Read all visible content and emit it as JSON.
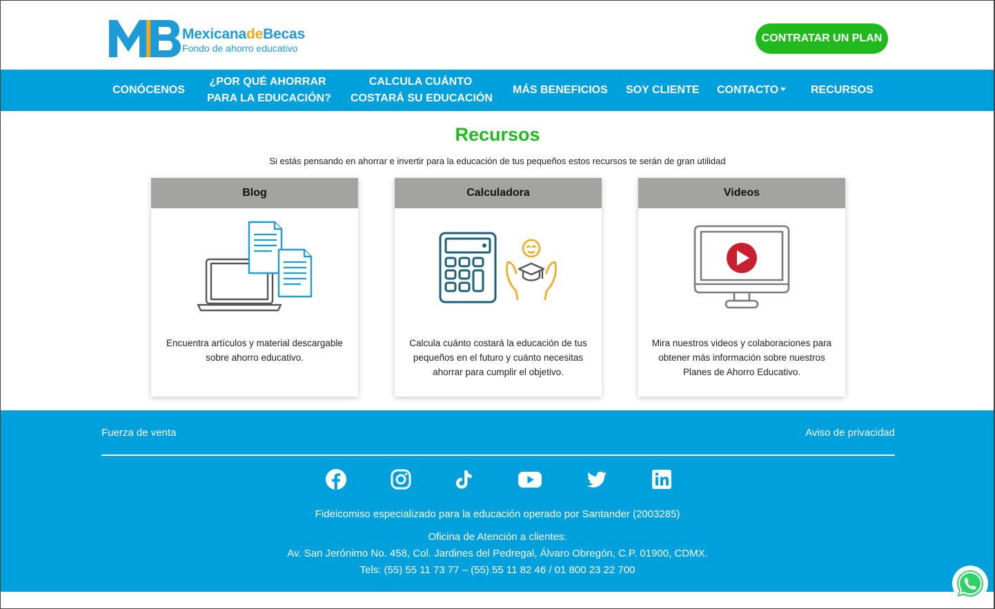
{
  "header": {
    "brand_part1": "Mexicana",
    "brand_part2": "de",
    "brand_part3": "Becas",
    "tagline": "Fondo de ahorro educativo",
    "cta_label": "CONTRATAR UN PLAN"
  },
  "nav": {
    "items": [
      {
        "line1": "CONÓCENOS",
        "line2": ""
      },
      {
        "line1": "¿POR QUÉ AHORRAR",
        "line2": "PARA LA EDUCACIÓN?"
      },
      {
        "line1": "CALCULA CUÁNTO",
        "line2": "COSTARÁ SU EDUCACIÓN"
      },
      {
        "line1": "MÁS BENEFICIOS",
        "line2": ""
      },
      {
        "line1": "SOY CLIENTE",
        "line2": ""
      },
      {
        "line1": "CONTACTO",
        "line2": ""
      },
      {
        "line1": "RECURSOS",
        "line2": ""
      }
    ]
  },
  "main": {
    "title": "Recursos",
    "subtitle": "Si estás pensando en ahorrar e invertir para la educación de tus pequeños estos recursos te serán de gran utilidad",
    "cards": [
      {
        "title": "Blog",
        "text": "Encuentra artículos y material descargable sobre ahorro educativo.",
        "icon": "laptop-documents-icon"
      },
      {
        "title": "Calculadora",
        "text": "Calcula cuánto costará la educación de tus pequeños en el futuro y cuánto necesitas ahorrar para cumplir el objetivo.",
        "icon": "calculator-child-icon"
      },
      {
        "title": "Videos",
        "text": "Mira nuestros videos y colaboraciones para obtener más información sobre nuestros Planes de Ahorro Educativo.",
        "icon": "monitor-play-icon"
      }
    ]
  },
  "footer": {
    "left_link": "Fuerza de venta",
    "right_link": "Aviso de privacidad",
    "socials": [
      "facebook-icon",
      "instagram-icon",
      "tiktok-icon",
      "youtube-icon",
      "twitter-icon",
      "linkedin-icon"
    ],
    "trust_text": "Fideicomiso especializado para la educación operado por Santander (2003285)",
    "office_title": "Oficina de Atención a clientes:",
    "address": "Av. San Jerónimo No. 458, Col. Jardines del Pedregal, Álvaro Obregón, C.P. 01900, CDMX.",
    "phones": "Tels: (55) 55 11 73 77 – (55) 55 11 82 46 / 01 800 23 22 700"
  },
  "colors": {
    "brand_blue": "#00a0dc",
    "brand_green": "#21ba1e",
    "brand_orange": "#f2a81e",
    "card_header_gray": "#a3a3a2"
  }
}
